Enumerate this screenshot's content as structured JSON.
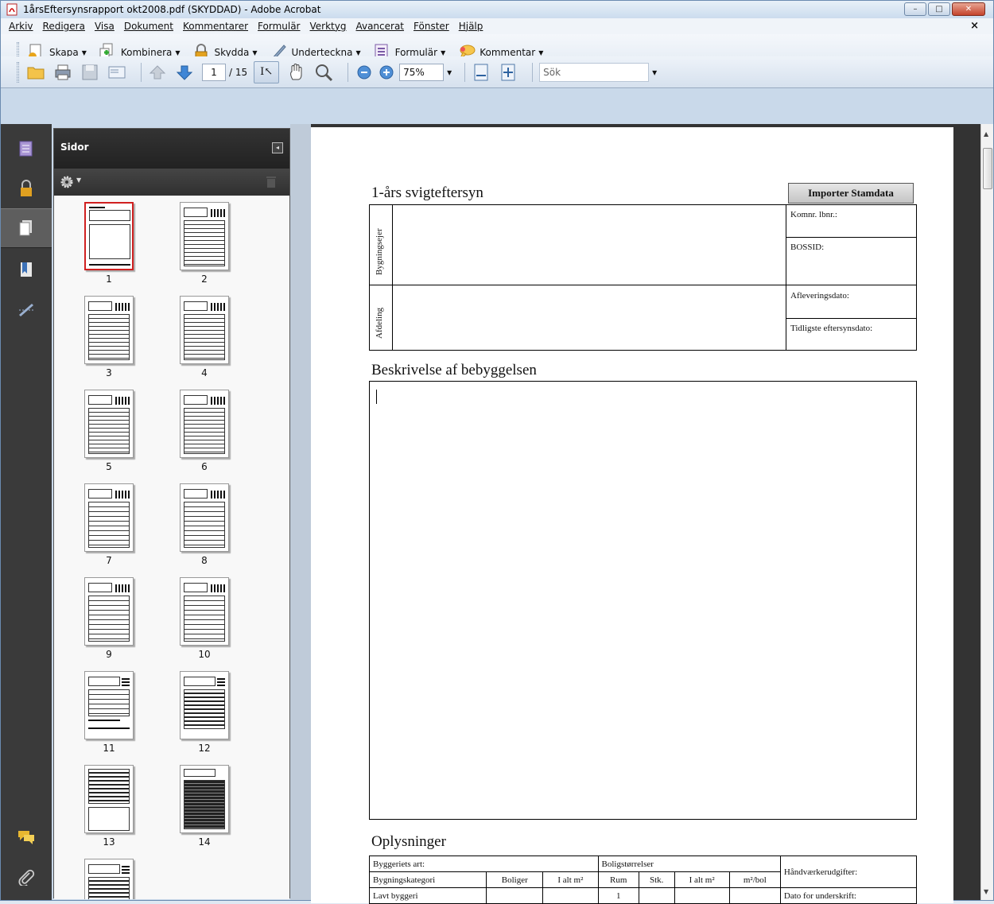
{
  "window": {
    "title": "1årsEftersynsrapport okt2008.pdf (SKYDDAD) - Adobe Acrobat",
    "min": "–",
    "max": "□",
    "close": "✕"
  },
  "menu": [
    "Arkiv",
    "Redigera",
    "Visa",
    "Dokument",
    "Kommentarer",
    "Formulär",
    "Verktyg",
    "Avancerat",
    "Fönster",
    "Hjälp"
  ],
  "menu_close": "×",
  "tasks": [
    {
      "label": "Skapa",
      "icon": "create-pdf-icon"
    },
    {
      "label": "Kombinera",
      "icon": "combine-icon"
    },
    {
      "label": "Skydda",
      "icon": "lock-icon"
    },
    {
      "label": "Underteckna",
      "icon": "pen-icon"
    },
    {
      "label": "Formulär",
      "icon": "form-icon"
    },
    {
      "label": "Kommentar",
      "icon": "comment-icon"
    }
  ],
  "nav": {
    "page_current": "1",
    "page_total": "/ 15",
    "zoom": "75%",
    "search_placeholder": "Sök"
  },
  "panel": {
    "title": "Sidor",
    "collapse": "◂",
    "pages": [
      "1",
      "2",
      "3",
      "4",
      "5",
      "6",
      "7",
      "8",
      "9",
      "10",
      "11",
      "12",
      "13",
      "14"
    ]
  },
  "doc": {
    "title": "1-års svigteftersyn",
    "import_button": "Importer Stamdata",
    "bygningsejer": "Bygningsejer",
    "afdeling": "Afdeling",
    "komnr": "Komnr. lbnr.:",
    "bossid": "BOSSID:",
    "afleveringsdato": "Afleveringsdato:",
    "tidligste": "Tidligste eftersynsdato:",
    "beskrivelse": "Beskrivelse af bebyggelsen",
    "oplysninger": "Oplysninger",
    "table": {
      "byggeriets_art": "Byggeriets art:",
      "boligstorrelser": "Boligstørrelser",
      "handvaerker": "Håndværkerudgifter:",
      "bygningskategori": "Bygningskategori",
      "boliger": "Boliger",
      "i_alt_m2": "I alt m²",
      "rum": "Rum",
      "stk": "Stk.",
      "i_alt_m2_b": "I alt m²",
      "m2_bol": "m²/bol",
      "lavt": "Lavt byggeri",
      "rum_1": "1",
      "dato": "Dato for underskrift:"
    }
  }
}
